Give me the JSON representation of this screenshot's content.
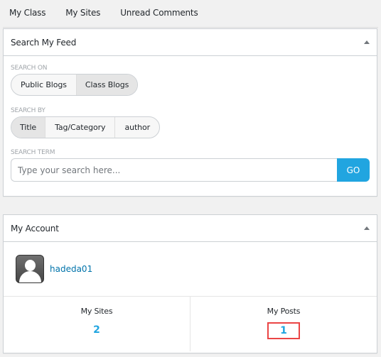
{
  "topnav": {
    "items": [
      {
        "label": "My Class"
      },
      {
        "label": "My Sites"
      },
      {
        "label": "Unread Comments"
      }
    ]
  },
  "search_panel": {
    "title": "Search My Feed",
    "toggle_icon": "triangle-up-icon",
    "search_on": {
      "label": "SEARCH ON",
      "options": [
        {
          "label": "Public Blogs",
          "active": false
        },
        {
          "label": "Class Blogs",
          "active": true
        }
      ]
    },
    "search_by": {
      "label": "SEARCH BY",
      "options": [
        {
          "label": "Title",
          "active": true
        },
        {
          "label": "Tag/Category",
          "active": false
        },
        {
          "label": "author",
          "active": false
        }
      ]
    },
    "search_term": {
      "label": "SEARCH TERM",
      "placeholder": "Type your search here...",
      "value": "",
      "button_label": "GO"
    }
  },
  "account_panel": {
    "title": "My Account",
    "toggle_icon": "triangle-up-icon",
    "avatar_icon": "user-silhouette-icon",
    "username": "hadeda01",
    "stats": [
      {
        "label": "My Sites",
        "value": "2",
        "highlighted": false
      },
      {
        "label": "My Posts",
        "value": "1",
        "highlighted": true
      }
    ]
  },
  "colors": {
    "accent": "#21a5e0",
    "link": "#0073aa",
    "highlight_border": "#ea4545",
    "background": "#f1f1f1"
  }
}
